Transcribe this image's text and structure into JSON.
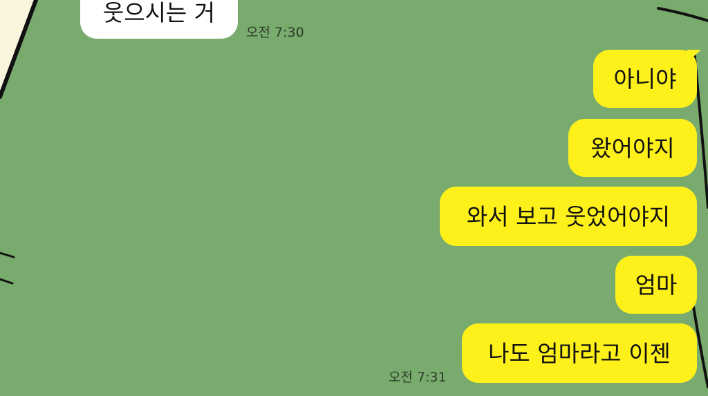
{
  "colors": {
    "chat_background": "#79AB6E",
    "incoming_bubble": "#FFFFFF",
    "outgoing_bubble": "#FEF01B",
    "wallpaper_paper": "#FAF5DD",
    "wallpaper_line": "#111111"
  },
  "messages": {
    "incoming_last": {
      "text": "웃으시는 거",
      "time": "오전 7:30"
    },
    "outgoing": [
      {
        "text": "아니야"
      },
      {
        "text": "왔어야지"
      },
      {
        "text": "와서 보고 웃었어야지"
      },
      {
        "text": "엄마"
      },
      {
        "text": "나도 엄마라고 이젠"
      }
    ],
    "outgoing_time": "오전 7:31"
  }
}
